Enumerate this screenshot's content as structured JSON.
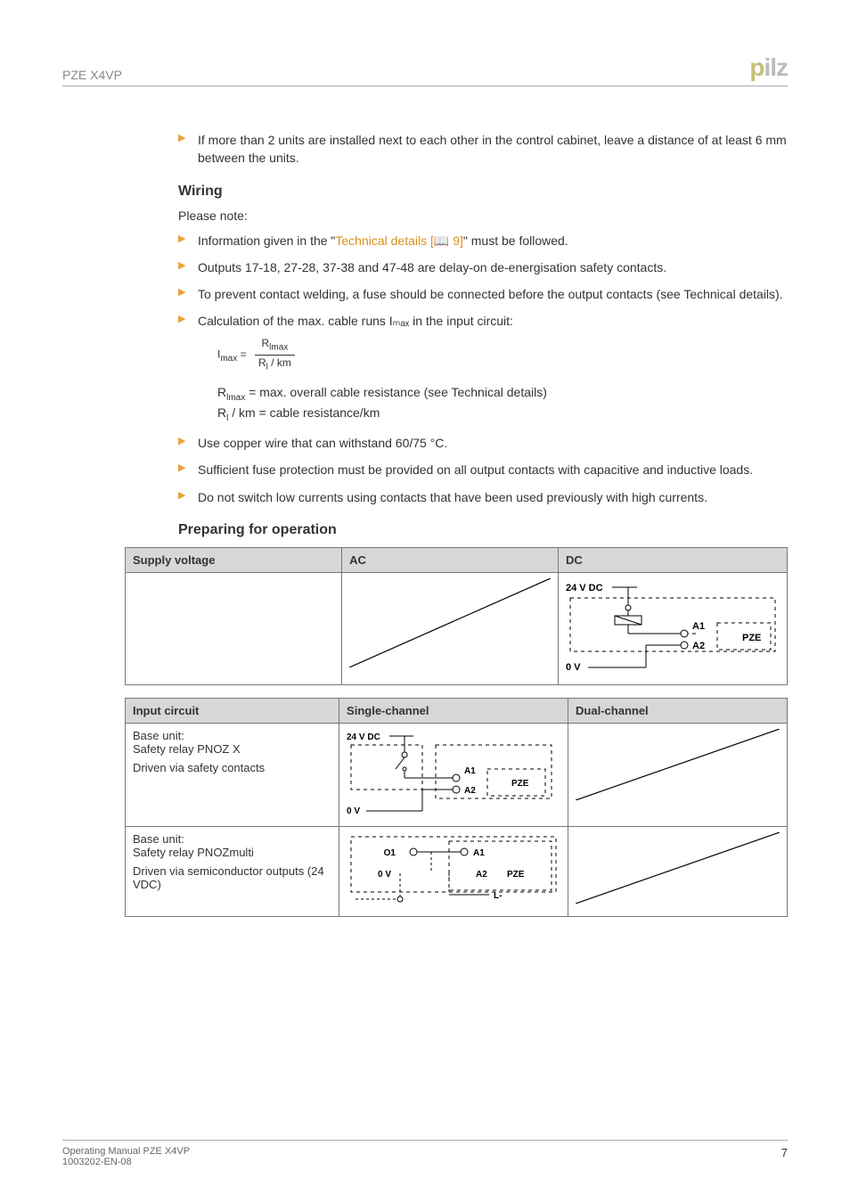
{
  "header": {
    "title": "PZE X4VP",
    "logo_letters": {
      "p": "p",
      "i": "i",
      "l": "l",
      "z": "z"
    }
  },
  "intro_bullet": "If more than 2 units are installed next to each other in the control cabinet, leave a distance of at least 6 mm between the units.",
  "wiring": {
    "heading": "Wiring",
    "lead": "Please note:",
    "b1_pre": "Information given in the \"",
    "b1_link": "Technical details [📖 9]",
    "b1_post": "\" must be followed.",
    "b2": "Outputs 17-18, 27-28, 37-38 and 47-48 are delay-on de-energisation safety contacts.",
    "b3": "To prevent contact welding, a fuse should be connected before the output contacts (see Technical details).",
    "b4": "Calculation of the max. cable runs Iₘₐₓ in the input circuit:",
    "formula_lhs": "I",
    "formula_lhs_sub": "max",
    "formula_eq": " = ",
    "formula_num": "R",
    "formula_num_sub": "lmax",
    "formula_den": "R",
    "formula_den_sub": "l",
    "formula_den_tail": " / km",
    "after1": "R",
    "after1_sub": "lmax",
    "after1_tail": " = max. overall cable resistance (see Technical details)",
    "after2": "R",
    "after2_sub": "l",
    "after2_tail": " / km = cable resistance/km",
    "b5": "Use copper wire that can withstand 60/75 °C.",
    "b6": "Sufficient fuse protection must be provided on all output contacts with capacitive and inductive loads.",
    "b7": "Do not switch low currents using contacts that have been used previously with high currents."
  },
  "prep": {
    "heading": "Preparing for operation",
    "t1": {
      "h1": "Supply voltage",
      "h2": "AC",
      "h3": "DC",
      "dc_top": "24 V DC",
      "dc_a1": "A1",
      "dc_a2": "A2",
      "dc_pze": "PZE",
      "dc_bot": "0 V"
    },
    "t2": {
      "h1": "Input circuit",
      "h2": "Single-channel",
      "h3": "Dual-channel",
      "r1c1a": "Base unit:",
      "r1c1b": "Safety relay PNOZ X",
      "r1c1c": "Driven via safety contacts",
      "r1_top": "24 V DC",
      "r1_a1": "A1",
      "r1_a2": "A2",
      "r1_pze": "PZE",
      "r1_bot": "0 V",
      "r2c1a": "Base unit:",
      "r2c1b": "Safety relay PNOZmulti",
      "r2c1c": "Driven via semiconductor outputs (24 VDC)",
      "r2_o1": "O1",
      "r2_a1": "A1",
      "r2_0v": "0 V",
      "r2_a2": "A2",
      "r2_pze": "PZE",
      "r2_l": "L-"
    }
  },
  "footer": {
    "l1": "Operating Manual PZE X4VP",
    "l2": "1003202-EN-08",
    "page": "7"
  }
}
